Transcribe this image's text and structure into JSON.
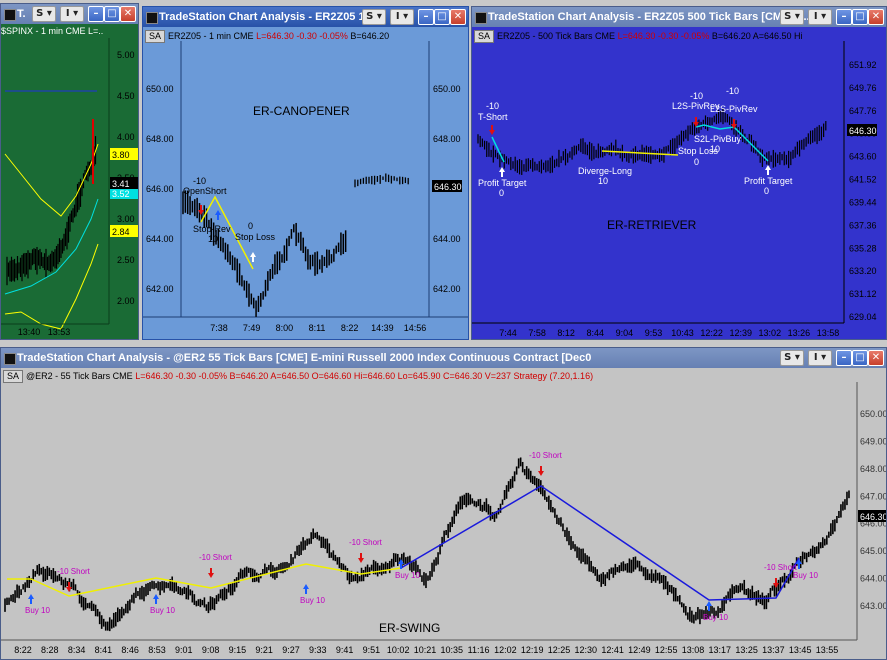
{
  "win1": {
    "title": "T.",
    "symbol": "$SPINX - 1 min  CME  L=..",
    "yticks": [
      "5.00",
      "4.50",
      "4.00",
      "3.50",
      "3.00",
      "2.50",
      "2.00"
    ],
    "badges": [
      "3.80",
      "3.52",
      "3.41",
      "2.84"
    ],
    "xticks": [
      "13:40",
      "13:53"
    ]
  },
  "win2": {
    "title": "TradeStation Chart Analysis - ER2Z05  1...",
    "symbol": "ER2Z05 - 1 min  CME",
    "quote": "L=646.30  -0.30  -0.05%",
    "bid": "B=646.20",
    "strategy": "ER-CANOPENER",
    "yticks": [
      "650.00",
      "648.00",
      "646.00",
      "644.00",
      "642.00"
    ],
    "price_badge": "646.30",
    "xticks": [
      "7:38",
      "7:49",
      "8:00",
      "8:11",
      "8:22",
      "14:39",
      "14:56"
    ],
    "annotations": {
      "a1_qty": "-10",
      "a1_label": "OpenShort",
      "a2_label": "Stop-Rev",
      "a2_qty": "10",
      "a3_qty": "0",
      "a3_label": "Stop Loss"
    }
  },
  "win3": {
    "title": "TradeStation Chart Analysis - ER2Z05  500 Tick Bars [CME]  E...",
    "symbol": "ER2Z05 - 500 Tick Bars  CME",
    "quote": "L=646.30  -0.30  -0.05%",
    "bid": "B=646.20",
    "ask": "A=646.50",
    "hi": "Hi",
    "strategy": "ER-RETRIEVER",
    "yticks": [
      "651.92",
      "649.76",
      "647.76",
      "645.60",
      "643.60",
      "641.52",
      "639.44",
      "637.36",
      "635.28",
      "633.20",
      "631.12",
      "629.04"
    ],
    "price_badge": "646.30",
    "xticks": [
      "7:44",
      "7:58",
      "8:12",
      "8:44",
      "9:04",
      "9:53",
      "10:43",
      "12:22",
      "12:39",
      "13:02",
      "13:26",
      "13:58"
    ],
    "annotations": {
      "tshort_qty": "-10",
      "tshort_label": "T-Short",
      "pt1_label": "Profit Target",
      "pt1_qty": "0",
      "dl_label": "Diverge-Long",
      "dl_qty": "10",
      "sl_label": "Stop Loss",
      "sl_qty": "0",
      "l2s1_qty": "-10",
      "l2s1_label": "L2S-PivRev",
      "l2s2_qty": "-10",
      "l2s2_label": "L2S-PivRev",
      "s2l_label": "S2L-PivBuy",
      "s2l_qty": "10",
      "pt2_label": "Profit Target",
      "pt2_qty": "0"
    }
  },
  "win4": {
    "title": "TradeStation Chart Analysis - @ER2  55 Tick Bars [CME]  E-mini Russell 2000 Index Continuous Contract [Dec0",
    "symbol": "@ER2 - 55 Tick Bars  CME",
    "quote": "L=646.30  -0.30  -0.05%  B=646.20  A=646.50  O=646.60  Hi=646.60  Lo=645.90  C=646.30  V=237  Strategy  (7.20,1.16)",
    "strategy": "ER-SWING",
    "yticks": [
      "650.00",
      "649.00",
      "648.00",
      "647.00",
      "646.00",
      "645.00",
      "644.00",
      "643.00"
    ],
    "price_badge": "646.30",
    "xticks": [
      "8:22",
      "8:28",
      "8:34",
      "8:41",
      "8:46",
      "8:53",
      "9:01",
      "9:08",
      "9:15",
      "9:21",
      "9:27",
      "9:33",
      "9:41",
      "9:51",
      "10:02",
      "10:21",
      "10:35",
      "11:16",
      "12:02",
      "12:19",
      "12:25",
      "12:30",
      "12:41",
      "12:49",
      "12:55",
      "13:08",
      "13:17",
      "13:25",
      "13:37",
      "13:45",
      "13:55"
    ],
    "trade_labels": [
      "Buy 10",
      "-10 Short",
      "Buy 10",
      "-10 Short",
      "Buy 10",
      "-10 Short",
      "Buy 10",
      "-10 Short",
      "Buy 10",
      "-10 Short",
      "Buy 10",
      "-10 Short",
      "Buy 10"
    ]
  },
  "colors": {
    "win2_bg": "#6b9ad8",
    "win3_bg": "#3333cc",
    "win1_bg": "#1a6b35",
    "win4_bg": "#c4c4c4",
    "trade_line_yellow": "#f0f000",
    "trade_line_blue": "#1a1adc",
    "buy_arrow": "#1a5cff",
    "sell_arrow": "#e01010",
    "price_badge_bg": "#000000"
  }
}
